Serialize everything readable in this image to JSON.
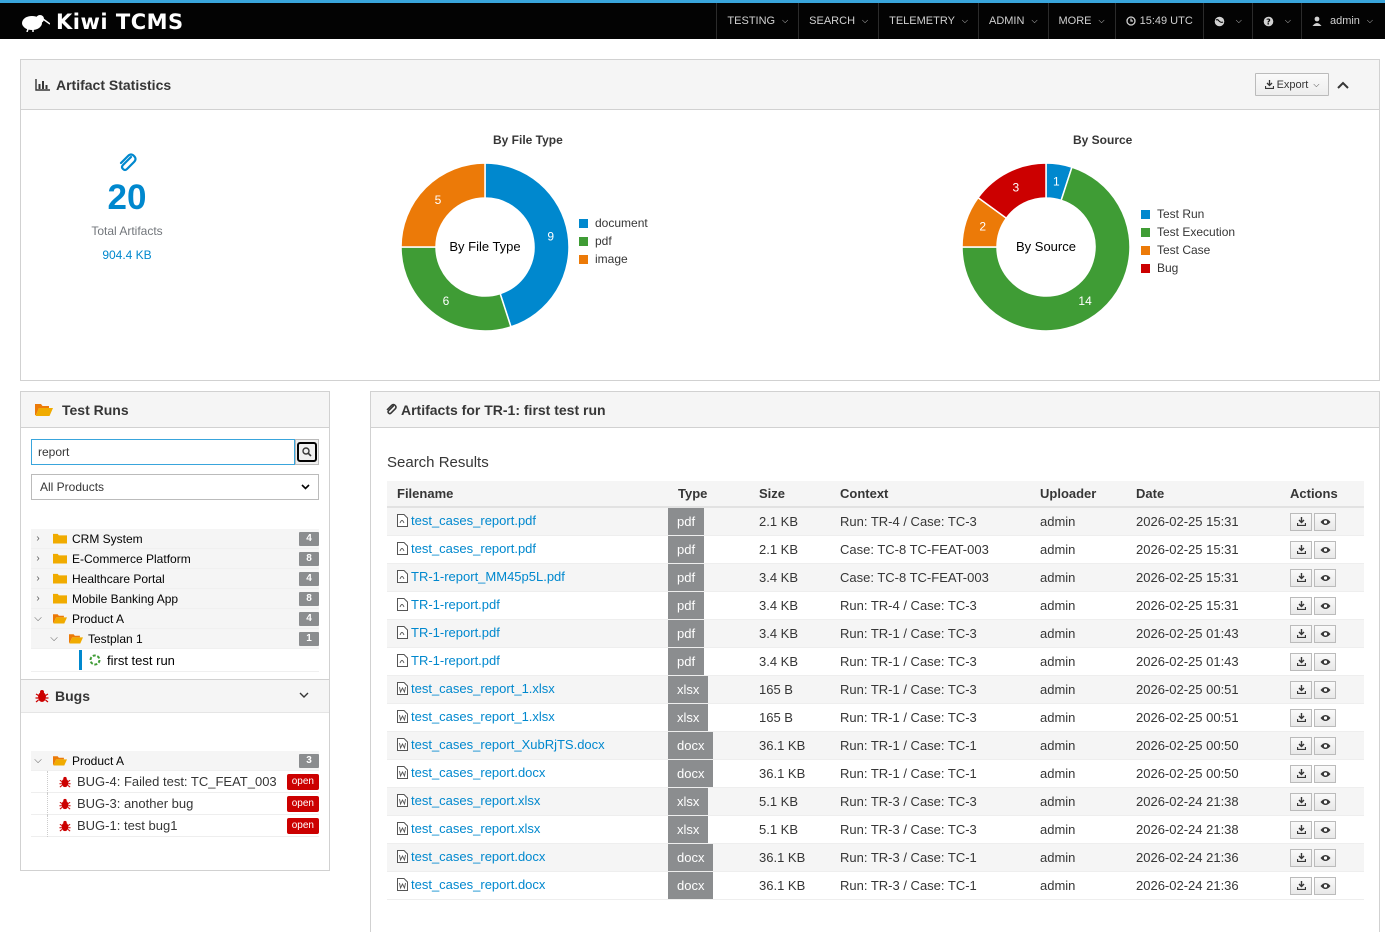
{
  "app": {
    "name": "Kiwi TCMS"
  },
  "nav": {
    "items": [
      "TESTING",
      "SEARCH",
      "TELEMETRY",
      "ADMIN",
      "MORE"
    ],
    "time": "15:49 UTC",
    "user": "admin"
  },
  "stats": {
    "title": "Artifact Statistics",
    "export_label": "Export",
    "total_count": "20",
    "total_label": "Total Artifacts",
    "total_size": "904.4 KB"
  },
  "chart_data": [
    {
      "type": "pie",
      "title": "By File Type",
      "center_label": "By File Type",
      "categories": [
        "document",
        "pdf",
        "image"
      ],
      "values": [
        9,
        6,
        5
      ],
      "colors": [
        "#0088ce",
        "#3f9c35",
        "#ec7a08"
      ]
    },
    {
      "type": "pie",
      "title": "By Source",
      "center_label": "By Source",
      "categories": [
        "Test Run",
        "Test Execution",
        "Test Case",
        "Bug"
      ],
      "values": [
        1,
        14,
        2,
        3
      ],
      "colors": [
        "#0088ce",
        "#3f9c35",
        "#ec7a08",
        "#cc0000"
      ]
    }
  ],
  "runs": {
    "title": "Test Runs",
    "search_value": "report",
    "product_filter": "All Products",
    "tree": [
      {
        "label": "CRM System",
        "count": "4",
        "chev": "›",
        "level": 0
      },
      {
        "label": "E-Commerce Platform",
        "count": "8",
        "chev": "›",
        "level": 0
      },
      {
        "label": "Healthcare Portal",
        "count": "4",
        "chev": "›",
        "level": 0
      },
      {
        "label": "Mobile Banking App",
        "count": "8",
        "chev": "›",
        "level": 0
      },
      {
        "label": "Product A",
        "count": "4",
        "chev": "⌄",
        "level": 0
      },
      {
        "label": "Testplan 1",
        "count": "1",
        "chev": "⌄",
        "level": 1
      },
      {
        "label": "first test run",
        "count": "",
        "chev": "",
        "level": 2
      }
    ]
  },
  "bugs": {
    "title": "Bugs",
    "product": "Product A",
    "product_count": "3",
    "items": [
      {
        "label": "BUG-4: Failed test: TC_FEAT_003",
        "status": "open"
      },
      {
        "label": "BUG-3: another bug",
        "status": "open"
      },
      {
        "label": "BUG-1: test bug1",
        "status": "open"
      }
    ]
  },
  "artifacts": {
    "title": "Artifacts for TR-1: first test run",
    "results_title": "Search Results",
    "columns": [
      "Filename",
      "Type",
      "Size",
      "Context",
      "Uploader",
      "Date",
      "Actions"
    ],
    "rows": [
      {
        "filename": "test_cases_report.pdf",
        "type": "pdf",
        "size": "2.1 KB",
        "context": "Run: TR-4 / Case: TC-3",
        "uploader": "admin",
        "date": "2026-02-25 15:31"
      },
      {
        "filename": "test_cases_report.pdf",
        "type": "pdf",
        "size": "2.1 KB",
        "context": "Case: TC-8 TC-FEAT-003",
        "uploader": "admin",
        "date": "2026-02-25 15:31"
      },
      {
        "filename": "TR-1-report_MM45p5L.pdf",
        "type": "pdf",
        "size": "3.4 KB",
        "context": "Case: TC-8 TC-FEAT-003",
        "uploader": "admin",
        "date": "2026-02-25 15:31"
      },
      {
        "filename": "TR-1-report.pdf",
        "type": "pdf",
        "size": "3.4 KB",
        "context": "Run: TR-4 / Case: TC-3",
        "uploader": "admin",
        "date": "2026-02-25 15:31"
      },
      {
        "filename": "TR-1-report.pdf",
        "type": "pdf",
        "size": "3.4 KB",
        "context": "Run: TR-1 / Case: TC-3",
        "uploader": "admin",
        "date": "2026-02-25 01:43"
      },
      {
        "filename": "TR-1-report.pdf",
        "type": "pdf",
        "size": "3.4 KB",
        "context": "Run: TR-1 / Case: TC-3",
        "uploader": "admin",
        "date": "2026-02-25 01:43"
      },
      {
        "filename": "test_cases_report_1.xlsx",
        "type": "xlsx",
        "size": "165 B",
        "context": "Run: TR-1 / Case: TC-3",
        "uploader": "admin",
        "date": "2026-02-25 00:51"
      },
      {
        "filename": "test_cases_report_1.xlsx",
        "type": "xlsx",
        "size": "165 B",
        "context": "Run: TR-1 / Case: TC-3",
        "uploader": "admin",
        "date": "2026-02-25 00:51"
      },
      {
        "filename": "test_cases_report_XubRjTS.docx",
        "type": "docx",
        "size": "36.1 KB",
        "context": "Run: TR-1 / Case: TC-1",
        "uploader": "admin",
        "date": "2026-02-25 00:50"
      },
      {
        "filename": "test_cases_report.docx",
        "type": "docx",
        "size": "36.1 KB",
        "context": "Run: TR-1 / Case: TC-1",
        "uploader": "admin",
        "date": "2026-02-25 00:50"
      },
      {
        "filename": "test_cases_report.xlsx",
        "type": "xlsx",
        "size": "5.1 KB",
        "context": "Run: TR-3 / Case: TC-3",
        "uploader": "admin",
        "date": "2026-02-24 21:38"
      },
      {
        "filename": "test_cases_report.xlsx",
        "type": "xlsx",
        "size": "5.1 KB",
        "context": "Run: TR-3 / Case: TC-3",
        "uploader": "admin",
        "date": "2026-02-24 21:38"
      },
      {
        "filename": "test_cases_report.docx",
        "type": "docx",
        "size": "36.1 KB",
        "context": "Run: TR-3 / Case: TC-1",
        "uploader": "admin",
        "date": "2026-02-24 21:36"
      },
      {
        "filename": "test_cases_report.docx",
        "type": "docx",
        "size": "36.1 KB",
        "context": "Run: TR-3 / Case: TC-1",
        "uploader": "admin",
        "date": "2026-02-24 21:36"
      }
    ]
  }
}
